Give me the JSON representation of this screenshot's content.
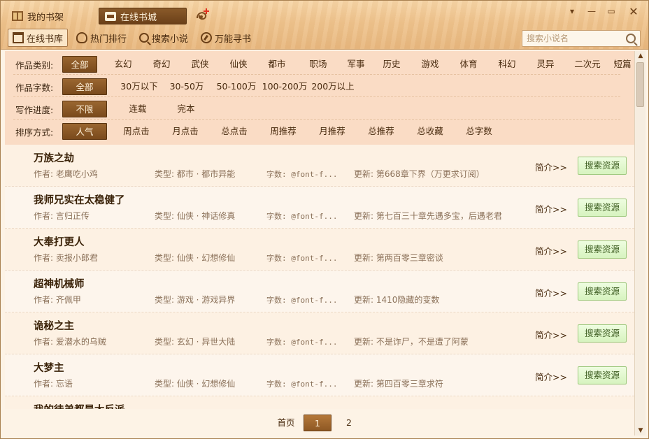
{
  "app": {
    "tabs": [
      {
        "label": "我的书架"
      },
      {
        "label": "在线书城"
      }
    ]
  },
  "window_controls": {
    "menu": "▾",
    "minimize": "—",
    "maximize": "▭",
    "close": "✕"
  },
  "subnav": [
    {
      "label": "在线书库"
    },
    {
      "label": "热门排行"
    },
    {
      "label": "搜索小说"
    },
    {
      "label": "万能寻书"
    }
  ],
  "search": {
    "placeholder": "搜索小说名"
  },
  "filters": [
    {
      "label": "作品类别:",
      "selected": 0,
      "options": [
        "全部",
        "玄幻",
        "奇幻",
        "武侠",
        "仙侠",
        "都市",
        "职场",
        "军事",
        "历史",
        "游戏",
        "体育",
        "科幻",
        "灵异",
        "二次元",
        "短篇"
      ]
    },
    {
      "label": "作品字数:",
      "selected": 0,
      "options": [
        "全部",
        "30万以下",
        "30-50万",
        "50-100万",
        "100-200万",
        "200万以上"
      ]
    },
    {
      "label": "写作进度:",
      "selected": 0,
      "options": [
        "不限",
        "连载",
        "完本"
      ]
    },
    {
      "label": "排序方式:",
      "selected": 0,
      "options": [
        "人气",
        "周点击",
        "月点击",
        "总点击",
        "周推荐",
        "月推荐",
        "总推荐",
        "总收藏",
        "总字数"
      ]
    }
  ],
  "books": [
    {
      "title": "万族之劫",
      "author": "作者: 老鹰吃小鸡",
      "type": "类型: 都市 · 都市异能",
      "count": "字数: @font-f...",
      "update": "更新: 第668章下界（万更求订阅）"
    },
    {
      "title": "我师兄实在太稳健了",
      "author": "作者: 言归正传",
      "type": "类型: 仙侠 · 神话修真",
      "count": "字数: @font-f...",
      "update": "更新: 第七百三十章先遇多宝，后遇老君"
    },
    {
      "title": "大奉打更人",
      "author": "作者: 卖报小郎君",
      "type": "类型: 仙侠 · 幻想修仙",
      "count": "字数: @font-f...",
      "update": "更新: 第两百零三章密谈"
    },
    {
      "title": "超神机械师",
      "author": "作者: 齐佩甲",
      "type": "类型: 游戏 · 游戏异界",
      "count": "字数: @font-f...",
      "update": "更新: 1410隐藏的变数"
    },
    {
      "title": "诡秘之主",
      "author": "作者: 爱潜水的乌贼",
      "type": "类型: 玄幻 · 异世大陆",
      "count": "字数: @font-f...",
      "update": "更新: 不是诈尸，不是遭了阿蒙"
    },
    {
      "title": "大梦主",
      "author": "作者: 忘语",
      "type": "类型: 仙侠 · 幻想修仙",
      "count": "字数: @font-f...",
      "update": "更新: 第四百零三章求符"
    },
    {
      "title": "我的徒弟都是大反派",
      "author": "",
      "type": "",
      "count": "",
      "update": ""
    }
  ],
  "row_actions": {
    "intro": "简介>>",
    "search_btn": "搜索资源"
  },
  "pager": {
    "first": "首页",
    "page1": "1",
    "page2": "2"
  },
  "colors": {
    "wood": "#efc48e",
    "accent_brown": "#7a4a1c",
    "filter_bg": "#fadcc5",
    "green_btn": "#d7f3bf"
  }
}
